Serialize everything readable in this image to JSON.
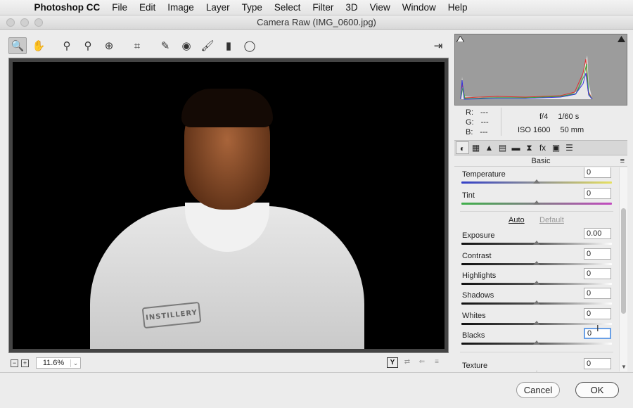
{
  "menubar": {
    "app": "Photoshop CC",
    "items": [
      "File",
      "Edit",
      "Image",
      "Layer",
      "Type",
      "Select",
      "Filter",
      "3D",
      "View",
      "Window",
      "Help"
    ]
  },
  "window": {
    "title": "Camera Raw (IMG_0600.jpg)"
  },
  "toolbar": {
    "tools": [
      {
        "name": "zoom-tool-icon",
        "glyph": "🔍",
        "active": true
      },
      {
        "name": "hand-tool-icon",
        "glyph": "✋"
      },
      {
        "name": "white-balance-tool-icon",
        "glyph": "⚲"
      },
      {
        "name": "color-sampler-tool-icon",
        "glyph": "⚲"
      },
      {
        "name": "targeted-adjustment-tool-icon",
        "glyph": "⊕"
      },
      {
        "name": "crop-tool-icon",
        "glyph": "⌗"
      },
      {
        "name": "spot-removal-tool-icon",
        "glyph": "✎"
      },
      {
        "name": "red-eye-tool-icon",
        "glyph": "◉"
      },
      {
        "name": "adjustment-brush-icon",
        "glyph": "🖌"
      },
      {
        "name": "graduated-filter-icon",
        "glyph": "▮"
      },
      {
        "name": "radial-filter-icon",
        "glyph": "◯"
      }
    ],
    "open_object_glyph": "⇥"
  },
  "preview": {
    "logo_text": "INSTILLERY"
  },
  "zoom": {
    "minus": "−",
    "plus": "+",
    "value": "11.6%",
    "dropdown": "⌄"
  },
  "view_buttons": {
    "y": "Y",
    "swap": "⇄",
    "copy": "⇐",
    "settings": "≡"
  },
  "info": {
    "r_label": "R:",
    "r_value": "---",
    "g_label": "G:",
    "g_value": "---",
    "b_label": "B:",
    "b_value": "---",
    "aperture": "f/4",
    "shutter": "1/60 s",
    "iso": "ISO 1600",
    "focal": "50 mm"
  },
  "panel": {
    "tabs": [
      "◐",
      "▦",
      "▲",
      "▤",
      "▬",
      "⧗",
      "fx",
      "▣",
      "☰"
    ],
    "title": "Basic",
    "menu_glyph": "≡",
    "auto": "Auto",
    "default": "Default",
    "sliders": [
      {
        "label": "Temperature",
        "value": "0",
        "pos": 0.5,
        "track": "temp"
      },
      {
        "label": "Tint",
        "value": "0",
        "pos": 0.5,
        "track": "tint"
      },
      {
        "label": "Exposure",
        "value": "0.00",
        "pos": 0.5,
        "track": "dark"
      },
      {
        "label": "Contrast",
        "value": "0",
        "pos": 0.5,
        "track": "dark"
      },
      {
        "label": "Highlights",
        "value": "0",
        "pos": 0.5,
        "track": "dark"
      },
      {
        "label": "Shadows",
        "value": "0",
        "pos": 0.5,
        "track": "dark"
      },
      {
        "label": "Whites",
        "value": "0",
        "pos": 0.5,
        "track": "dark"
      },
      {
        "label": "Blacks",
        "value": "0",
        "pos": 0.5,
        "track": "dark",
        "focused": true
      },
      {
        "label": "Texture",
        "value": "0",
        "pos": 0.5,
        "track": "dark"
      }
    ]
  },
  "buttons": {
    "cancel": "Cancel",
    "ok": "OK"
  },
  "colors": {
    "accent_focus": "#6aa0e6",
    "histogram_bg": "#9c9c9c"
  }
}
